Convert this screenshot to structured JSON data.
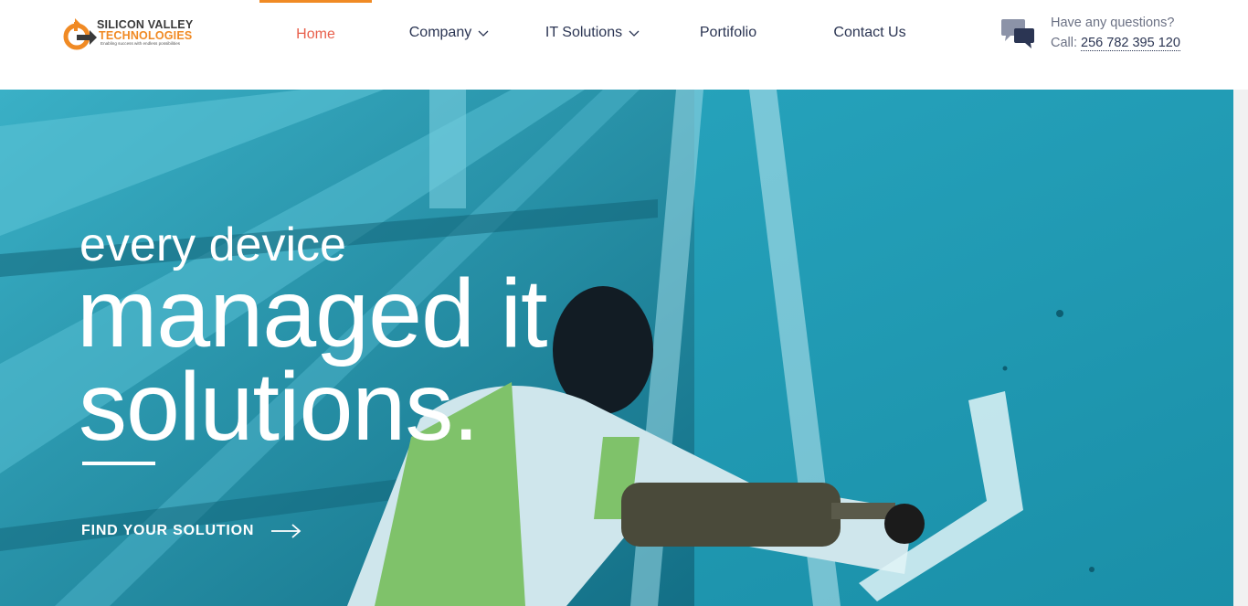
{
  "brand": {
    "name_line1": "SILICON VALLEY",
    "name_line2": "TECHNOLOGIES",
    "tagline": "Enabling success with endless possibilities",
    "accent_color": "#f08a24",
    "dark_color": "#3a3a3a"
  },
  "nav": {
    "items": [
      {
        "label": "Home",
        "active": true,
        "has_dropdown": false
      },
      {
        "label": "Company",
        "active": false,
        "has_dropdown": true
      },
      {
        "label": "IT Solutions",
        "active": false,
        "has_dropdown": true
      },
      {
        "label": "Portifolio",
        "active": false,
        "has_dropdown": false
      },
      {
        "label": "Contact Us",
        "active": false,
        "has_dropdown": false
      }
    ],
    "active_color": "#e8604c",
    "indicator_color": "#f08a24",
    "text_color": "#2b3553"
  },
  "contact": {
    "question": "Have any questions?",
    "call_prefix": "Call:",
    "phone": "256 782 395 120",
    "icon": "chat-bubbles-icon"
  },
  "hero": {
    "line1": "every device",
    "line2": "managed it",
    "line3": "solutions.",
    "cta_label": "FIND YOUR SOLUTION",
    "cta_icon": "arrow-right-icon",
    "overlay_color": "#1d8fa9"
  }
}
